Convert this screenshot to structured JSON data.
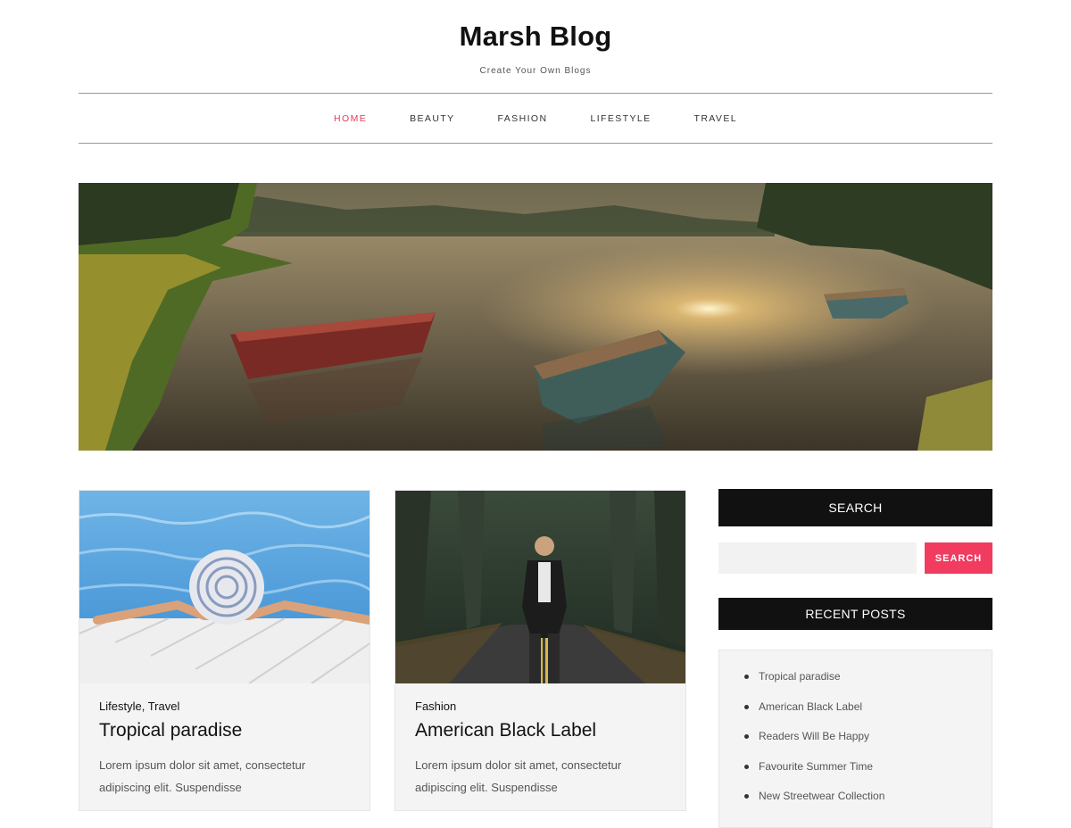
{
  "site": {
    "title": "Marsh Blog",
    "tagline": "Create Your Own Blogs"
  },
  "nav": {
    "items": [
      {
        "label": "HOME",
        "active": true
      },
      {
        "label": "BEAUTY",
        "active": false
      },
      {
        "label": "FASHION",
        "active": false
      },
      {
        "label": "LIFESTYLE",
        "active": false
      },
      {
        "label": "TRAVEL",
        "active": false
      }
    ],
    "active_color": "#e8385a"
  },
  "posts": [
    {
      "categories": [
        "Lifestyle",
        "Travel"
      ],
      "category_separator": ",",
      "title": "Tropical paradise",
      "excerpt_line1": "Lorem ipsum dolor sit amet, consectetur",
      "excerpt_line2": "adipiscing elit. Suspendisse"
    },
    {
      "categories": [
        "Fashion"
      ],
      "title": "American Black Label",
      "excerpt_line1": "Lorem ipsum dolor sit amet, consectetur",
      "excerpt_line2": "adipiscing elit. Suspendisse"
    }
  ],
  "sidebar": {
    "search_title": "SEARCH",
    "search_placeholder": "",
    "search_button": "SEARCH",
    "recent_title": "RECENT POSTS",
    "recent_posts": [
      "Tropical paradise",
      "American Black Label",
      "Readers Will Be Happy",
      "Favourite Summer Time",
      "New Streetwear Collection"
    ]
  },
  "colors": {
    "accent": "#f13b5f",
    "widget_bg": "#111111"
  }
}
